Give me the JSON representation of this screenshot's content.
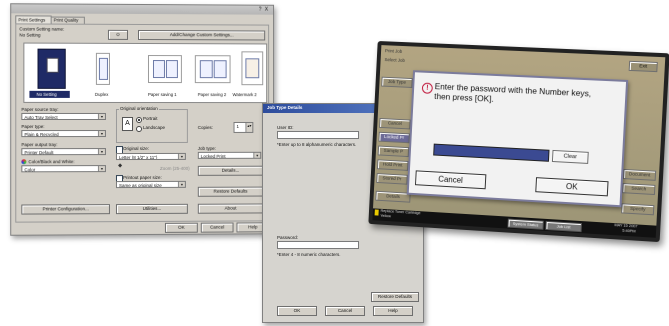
{
  "print_dialog": {
    "title_controls": "? X",
    "tabs": [
      "Print Settings",
      "Print Quality"
    ],
    "custom_setting_label": "Custom Setting name:",
    "custom_setting_value": "No Setting",
    "add_change_button": "Add/Change Custom Settings...",
    "thumbnails": [
      "No Setting",
      "Duplex",
      "Paper saving 1",
      "Paper saving 2",
      "Watermark 2"
    ],
    "paper_source_label": "Paper source tray:",
    "paper_source_value": "Auto Tray Select",
    "paper_type_label": "Paper type:",
    "paper_type_value": "Plain & Recycled",
    "paper_output_label": "Paper output tray:",
    "paper_output_value": "Printer Default",
    "color_label": "Color/Black and White:",
    "color_value": "Color",
    "orientation_label": "Original orientation",
    "portrait_label": "Portrait",
    "landscape_label": "Landscape",
    "copies_label": "Copies:",
    "copies_value": "1",
    "original_size_label": "Original size:",
    "original_size_value": "Letter (8 1/2\" x 11\")",
    "zoom_label": "Zoom (25-400)",
    "printout_size_label": "Printout paper size:",
    "printout_size_value": "Same as original size",
    "job_type_label": "Job type:",
    "job_type_value": "Locked Print",
    "details_button": "Details...",
    "restore_defaults_button": "Restore Defaults",
    "printer_config_button": "Printer Configuration...",
    "utilities_button": "Utilities...",
    "about_button": "About",
    "ok_button": "OK",
    "cancel_button": "Cancel",
    "help_button": "Help"
  },
  "job_type_dialog": {
    "title": "Job Type Details",
    "user_id_label": "User ID:",
    "user_id_hint": "*Enter up to 8 alphanumeric characters.",
    "password_label": "Password:",
    "password_hint": "*Enter 4 - 8 numeric characters.",
    "restore_defaults_button": "Restore Defaults",
    "ok_button": "OK",
    "cancel_button": "Cancel",
    "help_button": "Help"
  },
  "panel": {
    "top_left_title": "Print Job",
    "top_left_sub": "Select Job",
    "exit_button": "Exit",
    "prompt_line1": "Enter the password with the Number keys,",
    "prompt_line2": "then press [OK].",
    "clear_button": "Clear",
    "cancel_button": "Cancel",
    "ok_button": "OK",
    "side_left_items": [
      "Job Type",
      "Cancel",
      "Locked Pr",
      "Sample P",
      "Hold Print",
      "Stored Pr"
    ],
    "side_right_items": [
      "Document",
      "Search",
      "Specify"
    ],
    "details_button": "Details",
    "status_left": "Replace Toner Cartridge",
    "status_left_sub": "Yellow",
    "status_btn1": "System Status",
    "status_btn2": "Job List",
    "datetime": "MAY 15 2007",
    "time": "5:40PM"
  },
  "colors": {
    "dialog_bg": "#d4d0c8",
    "panel_bezel": "#2b2b2b",
    "lcd_bg": "#c8b98a",
    "accent_blue": "#3b4a92",
    "dialog_title_blue": "#2d4c9c"
  }
}
